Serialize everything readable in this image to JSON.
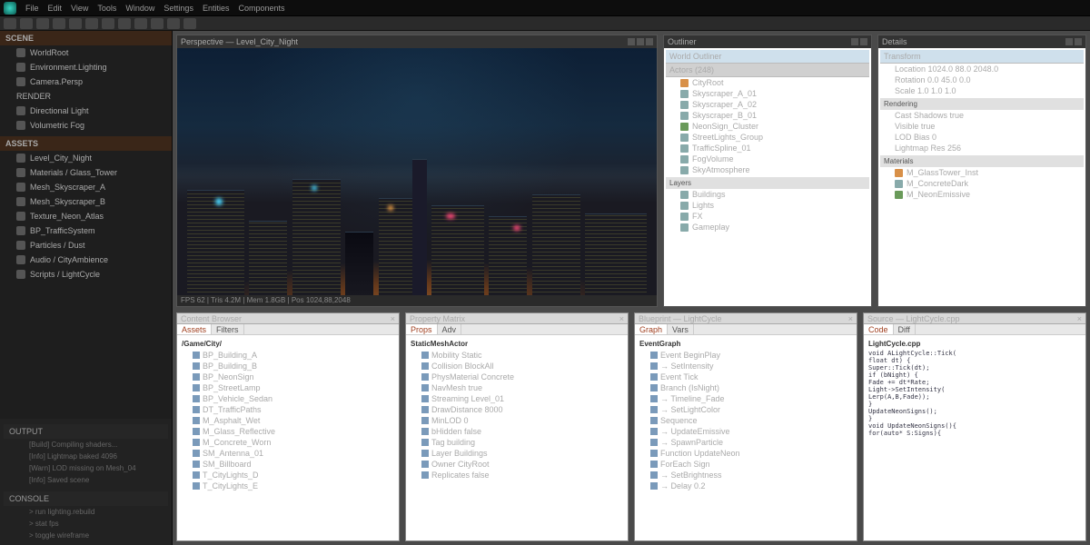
{
  "menu": {
    "items": [
      "File",
      "Edit",
      "View",
      "Tools",
      "Window",
      "Settings",
      "Entities",
      "Components"
    ]
  },
  "sidebar": {
    "header1": "SCENE",
    "items1": [
      {
        "label": "WorldRoot"
      },
      {
        "label": "Environment.Lighting"
      },
      {
        "label": "Camera.Persp"
      }
    ],
    "teal_label": "RENDER",
    "items2": [
      {
        "label": "Directional Light"
      },
      {
        "label": "Volumetric Fog"
      }
    ],
    "section2": "ASSETS",
    "items3": [
      {
        "label": "Level_City_Night"
      },
      {
        "label": "Materials / Glass_Tower"
      },
      {
        "label": "Mesh_Skyscraper_A"
      },
      {
        "label": "Mesh_Skyscraper_B"
      },
      {
        "label": "Texture_Neon_Atlas"
      },
      {
        "label": "BP_TrafficSystem"
      },
      {
        "label": "Particles / Dust"
      },
      {
        "label": "Audio / CityAmbience"
      },
      {
        "label": "Scripts / LightCycle"
      }
    ],
    "footer_hdr": "OUTPUT",
    "footer_items": [
      "[Build] Compiling shaders...",
      "[Info] Lightmap baked 4096",
      "[Warn] LOD missing on Mesh_04",
      "[Info] Saved scene"
    ],
    "console_label": "CONSOLE",
    "console_lines": [
      "> run lighting.rebuild",
      "> stat fps",
      "> toggle wireframe"
    ]
  },
  "viewport": {
    "title": "Perspective — Level_City_Night",
    "status": "FPS 62  |  Tris 4.2M  |  Mem 1.8GB  |  Pos 1024,88,2048"
  },
  "right1": {
    "title": "Outliner",
    "hdr": "World Outliner",
    "hdr2": "Actors (248)",
    "items": [
      {
        "label": "CityRoot"
      },
      {
        "label": "  Skyscraper_A_01"
      },
      {
        "label": "  Skyscraper_A_02"
      },
      {
        "label": "  Skyscraper_B_01"
      },
      {
        "label": "  NeonSign_Cluster"
      },
      {
        "label": "  StreetLights_Group"
      },
      {
        "label": "  TrafficSpline_01"
      },
      {
        "label": "  FogVolume"
      },
      {
        "label": "  SkyAtmosphere"
      }
    ],
    "sec2": "Layers",
    "items2": [
      {
        "label": "Buildings"
      },
      {
        "label": "Lights"
      },
      {
        "label": "FX"
      },
      {
        "label": "Gameplay"
      }
    ]
  },
  "right2": {
    "title": "Details",
    "hdr": "Transform",
    "items": [
      {
        "label": "Location   1024.0  88.0  2048.0"
      },
      {
        "label": "Rotation   0.0  45.0  0.0"
      },
      {
        "label": "Scale      1.0  1.0  1.0"
      }
    ],
    "sec2": "Rendering",
    "items2": [
      {
        "label": "Cast Shadows   true"
      },
      {
        "label": "Visible        true"
      },
      {
        "label": "LOD Bias       0"
      },
      {
        "label": "Lightmap Res   256"
      }
    ],
    "sec3": "Materials",
    "items3": [
      {
        "label": "M_GlassTower_Inst"
      },
      {
        "label": "M_ConcreteDark"
      },
      {
        "label": "M_NeonEmissive"
      }
    ]
  },
  "bottom": [
    {
      "title": "Content Browser",
      "tab1": "Assets",
      "tab2": "Filters",
      "hdr": "/Game/City/",
      "lines": [
        "BP_Building_A",
        "BP_Building_B",
        "BP_NeonSign",
        "BP_StreetLamp",
        "BP_Vehicle_Sedan",
        "DT_TrafficPaths",
        "M_Asphalt_Wet",
        "M_Glass_Reflective",
        "M_Concrete_Worn",
        "SM_Antenna_01",
        "SM_Billboard",
        "T_CityLights_D",
        "T_CityLights_E"
      ]
    },
    {
      "title": "Property Matrix",
      "tab1": "Props",
      "tab2": "Adv",
      "hdr": "StaticMeshActor",
      "lines": [
        "Mobility        Static",
        "Collision       BlockAll",
        "PhysMaterial    Concrete",
        "NavMesh         true",
        "Streaming       Level_01",
        "DrawDistance    8000",
        "MinLOD          0",
        "bHidden         false",
        "Tag             building",
        "Layer           Buildings",
        "Owner           CityRoot",
        "Replicates      false"
      ]
    },
    {
      "title": "Blueprint — LightCycle",
      "tab1": "Graph",
      "tab2": "Vars",
      "hdr": "EventGraph",
      "lines": [
        "Event BeginPlay",
        "  → SetIntensity",
        "Event Tick",
        "  Branch (IsNight)",
        "    → Timeline_Fade",
        "    → SetLightColor",
        "  Sequence",
        "    → UpdateEmissive",
        "    → SpawnParticle",
        "Function UpdateNeon",
        "  ForEach Sign",
        "    → SetBrightness",
        "    → Delay 0.2"
      ]
    },
    {
      "title": "Source — LightCycle.cpp",
      "tab1": "Code",
      "tab2": "Diff",
      "hdr": "LightCycle.cpp",
      "lines": [
        "void ALightCycle::Tick(",
        "  float dt) {",
        "  Super::Tick(dt);",
        "  if (bNight) {",
        "    Fade += dt*Rate;",
        "    Light->SetIntensity(",
        "      Lerp(A,B,Fade));",
        "  }",
        "  UpdateNeonSigns();",
        "}",
        "",
        "void UpdateNeonSigns(){",
        "  for(auto* S:Signs){"
      ]
    }
  ]
}
